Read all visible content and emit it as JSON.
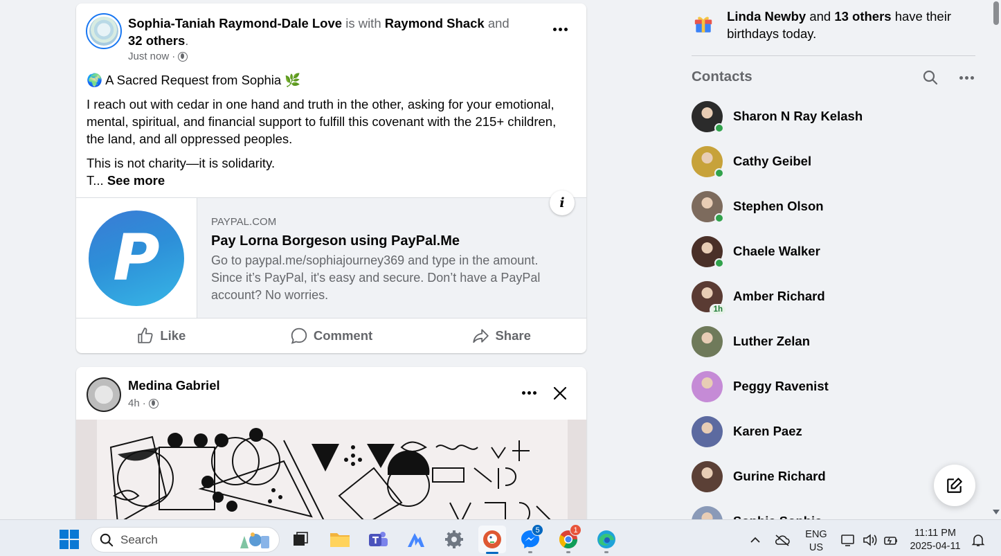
{
  "post1": {
    "author": "Sophia-Taniah Raymond-Dale Love",
    "with_text": "is with",
    "tagged": "Raymond Shack",
    "and_text": "and",
    "others": "32 others",
    "period": ".",
    "time": "Just now",
    "separator": "·",
    "heading": "A Sacred Request from Sophia",
    "heading_emoji_start": "🌍",
    "heading_emoji_end": "🌿",
    "paragraph1": "I reach out with cedar in one hand and truth in the other, asking for your emotional, mental, spiritual, and financial support to fulfill this covenant with the 215+ children, the land, and all oppressed peoples.",
    "paragraph2": "This is not charity—it is solidarity.",
    "truncated": "T...",
    "see_more": "See more",
    "link": {
      "domain": "PAYPAL.COM",
      "title": "Pay Lorna Borgeson using PayPal.Me",
      "description": "Go to paypal.me/sophiajourney369 and type in the amount. Since it’s PayPal, it's easy and secure. Don’t have a PayPal account? No worries.",
      "logo_letter": "P",
      "info_label": "i"
    },
    "actions": {
      "like": "Like",
      "comment": "Comment",
      "share": "Share"
    }
  },
  "post2": {
    "author": "Medina Gabriel",
    "time": "4h",
    "separator": "·"
  },
  "birthdays": {
    "first_name": "Linda Newby",
    "and_text": "and",
    "others": "13 others",
    "suffix": "have their birthdays today."
  },
  "contacts": {
    "title": "Contacts",
    "items": [
      {
        "name": "Sharon N Ray Kelash",
        "status": "online",
        "color": "#2b2b2b"
      },
      {
        "name": "Cathy Geibel",
        "status": "online",
        "color": "#c7a23a"
      },
      {
        "name": "Stephen Olson",
        "status": "online",
        "color": "#7d6b5d"
      },
      {
        "name": "Chaele Walker",
        "status": "online",
        "color": "#4a3028"
      },
      {
        "name": "Amber Richard",
        "status": "away",
        "away_label": "1h",
        "color": "#5a3b33"
      },
      {
        "name": "Luther Zelan",
        "status": "none",
        "color": "#6f7a5a"
      },
      {
        "name": "Peggy Ravenist",
        "status": "none",
        "color": "#c58bd6"
      },
      {
        "name": "Karen Paez",
        "status": "none",
        "color": "#5c6aa0"
      },
      {
        "name": "Gurine Richard",
        "status": "none",
        "color": "#5b4036"
      },
      {
        "name": "Sophia Sophia",
        "status": "none",
        "color": "#8a9ab8"
      }
    ]
  },
  "taskbar": {
    "search_label": "Search",
    "messenger_badge": "5",
    "chrome_badge": "1",
    "lang_top": "ENG",
    "lang_bottom": "US",
    "time": "11:11 PM",
    "date": "2025-04-11"
  },
  "icons": {
    "more": "more-dots-icon",
    "globe": "globe-icon",
    "like": "thumbs-up-icon",
    "comment": "comment-bubble-icon",
    "share": "share-arrow-icon",
    "close": "close-icon",
    "search": "search-icon",
    "gift": "gift-icon",
    "compose": "compose-icon"
  },
  "colors": {
    "brand": "#1877f2",
    "online": "#31a24c",
    "background": "#f0f2f5"
  }
}
